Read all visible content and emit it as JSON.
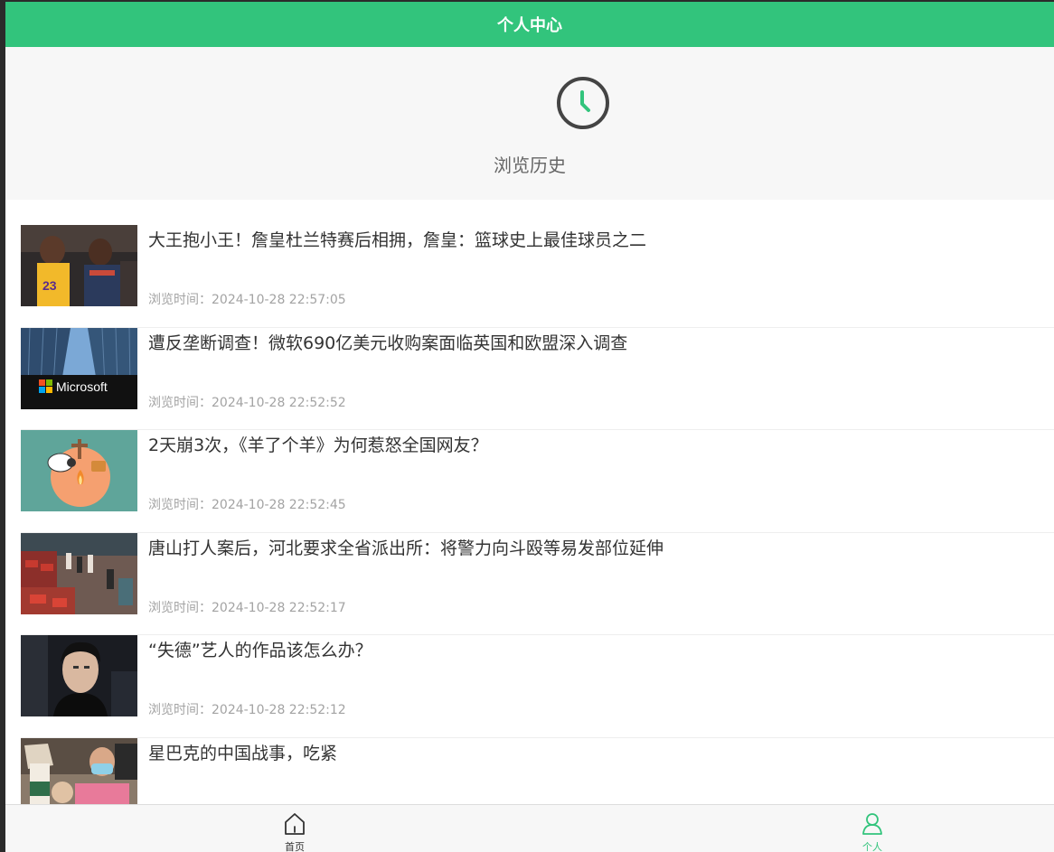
{
  "header": {
    "title": "个人中心"
  },
  "hero": {
    "icon": "clock-icon",
    "label": "浏览历史",
    "accent": "#32c47c"
  },
  "history": {
    "items": [
      {
        "title": "大王抱小王！詹皇杜兰特赛后相拥，詹皇：篮球史上最佳球员之二",
        "time_label": "浏览时间：2024-10-28 22:57:05",
        "thumb": "basketball-players-thumbnail"
      },
      {
        "title": "遭反垄断调查！微软690亿美元收购案面临英国和欧盟深入调查",
        "time_label": "浏览时间：2024-10-28 22:52:52",
        "thumb": "microsoft-building-thumbnail",
        "thumb_text": "Microsoft"
      },
      {
        "title": "2天崩3次，《羊了个羊》为何惹怒全国网友？",
        "time_label": "浏览时间：2024-10-28 22:52:45",
        "thumb": "sheep-game-thumbnail"
      },
      {
        "title": "唐山打人案后，河北要求全省派出所：将警力向斗殴等易发部位延伸",
        "time_label": "浏览时间：2024-10-28 22:52:17",
        "thumb": "surveillance-scene-thumbnail"
      },
      {
        "title": "“失德”艺人的作品该怎么办？",
        "time_label": "浏览时间：2024-10-28 22:52:12",
        "thumb": "actor-portrait-thumbnail"
      },
      {
        "title": "星巴克的中国战事，吃紧",
        "time_label": "",
        "thumb": "starbucks-cup-thumbnail"
      }
    ]
  },
  "tabbar": {
    "tabs": [
      {
        "label": "首页",
        "icon": "home-icon",
        "active": false
      },
      {
        "label": "个人",
        "icon": "user-icon",
        "active": true
      }
    ]
  }
}
